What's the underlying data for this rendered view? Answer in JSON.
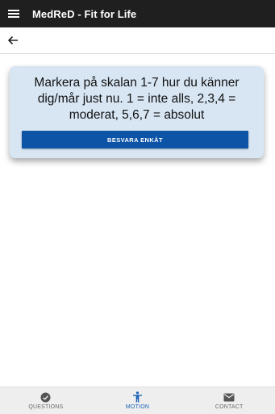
{
  "app_bar": {
    "title": "MedReD - Fit for Life",
    "menu_icon": "hamburger-menu-icon"
  },
  "sub_bar": {
    "back_icon": "arrow-back-icon"
  },
  "card": {
    "text": "Markera på skalan 1-7 hur du känner dig/mår just nu. 1 = inte alls, 2,3,4 = moderat, 5,6,7 = absolut",
    "button_label": "BESVARA ENKÄT"
  },
  "bottom_nav": {
    "items": [
      {
        "label": "QUESTIONS",
        "icon": "check-circle-icon",
        "active": false
      },
      {
        "label": "MOTION",
        "icon": "accessibility-person-icon",
        "active": true
      },
      {
        "label": "CONTACT",
        "icon": "mail-icon",
        "active": false
      }
    ]
  },
  "colors": {
    "app_bar_bg": "#1f1f1f",
    "card_bg": "#d8e6f4",
    "button_bg": "#0e54a6",
    "active_nav": "#1a5fb4",
    "inactive_nav": "#6a6a6a"
  }
}
